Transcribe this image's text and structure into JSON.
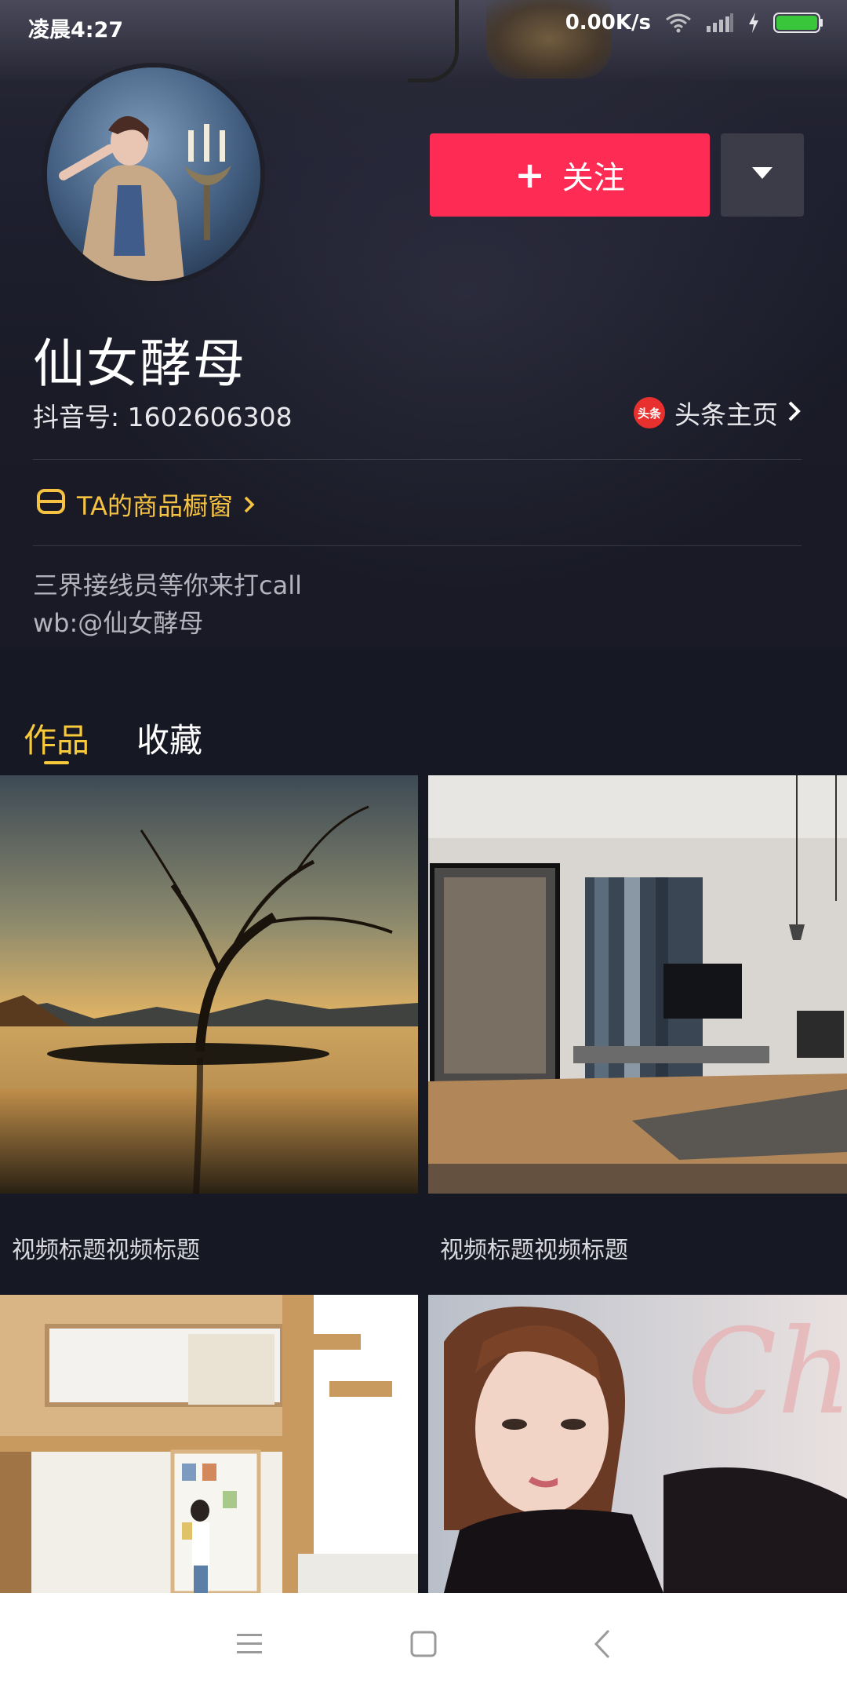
{
  "status_bar": {
    "time": "凌晨4:27",
    "network_speed": "0.00K/s",
    "icons": [
      "wifi-icon",
      "signal-icon",
      "charging-bolt-icon",
      "battery-icon"
    ]
  },
  "header": {
    "follow_label": "关注",
    "follow_icon": "plus-icon",
    "more_icon": "caret-down-icon"
  },
  "profile": {
    "name": "仙女酵母",
    "douyin_id": "抖音号: 1602606308",
    "toutiao": {
      "badge": "头条",
      "label": "头条主页"
    },
    "shop_window": "TA的商品橱窗",
    "bio_line1": "三界接线员等你来打call",
    "bio_line2": "wb:@仙女酵母"
  },
  "tabs": [
    {
      "label": "作品",
      "active": true
    },
    {
      "label": "收藏",
      "active": false
    }
  ],
  "videos": [
    {
      "title": "视频标题视频标题",
      "scene": "lone-tree-lake"
    },
    {
      "title": "视频标题视频标题",
      "scene": "living-room"
    },
    {
      "scene": "loft-bookshelf"
    },
    {
      "scene": "portrait-woman"
    }
  ],
  "nav_bar": {
    "buttons": [
      "menu-icon",
      "home-square-icon",
      "back-chevron-icon"
    ]
  },
  "colors": {
    "background": "#161823",
    "follow_button": "#fe2c55",
    "more_button": "#3b3c47",
    "active_tab": "#f8c93b",
    "shop_window": "#f5c242",
    "toutiao_badge": "#e8312f"
  }
}
